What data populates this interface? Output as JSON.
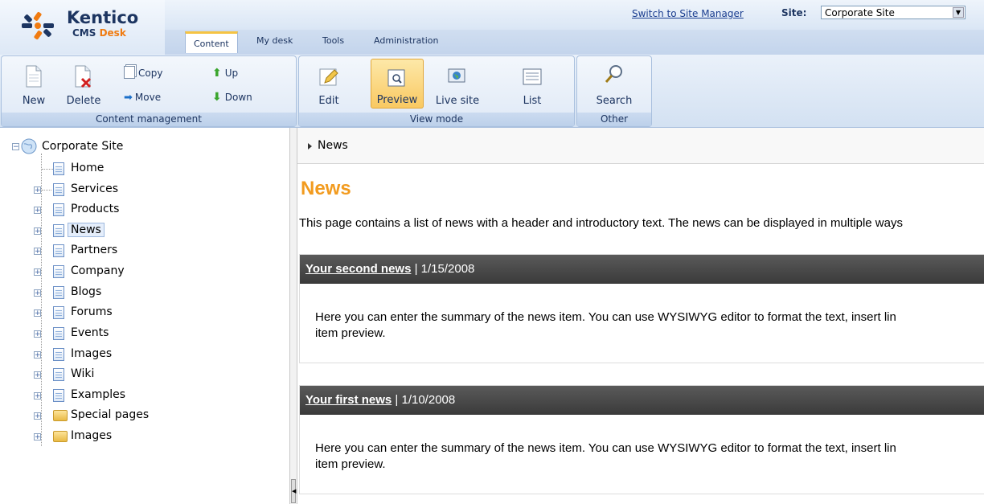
{
  "header": {
    "logo_name": "Kentico",
    "logo_product_cms": "CMS",
    "logo_product_desk": "Desk",
    "switch_link": "Switch to Site Manager",
    "site_label": "Site:",
    "site_value": "Corporate Site",
    "tabs": [
      {
        "label": "Content",
        "active": true
      },
      {
        "label": "My desk",
        "active": false
      },
      {
        "label": "Tools",
        "active": false
      },
      {
        "label": "Administration",
        "active": false
      }
    ]
  },
  "ribbon": {
    "content_management": {
      "label": "Content management",
      "new": "New",
      "delete": "Delete",
      "copy": "Copy",
      "move": "Move",
      "up": "Up",
      "down": "Down"
    },
    "view_mode": {
      "label": "View mode",
      "edit": "Edit",
      "preview": "Preview",
      "live_site": "Live site",
      "list": "List",
      "selected": "Preview"
    },
    "other": {
      "label": "Other",
      "search": "Search"
    }
  },
  "tree": {
    "root": "Corporate Site",
    "items": [
      {
        "label": "Home",
        "type": "document",
        "expandable": false
      },
      {
        "label": "Services",
        "type": "document",
        "expandable": true
      },
      {
        "label": "Products",
        "type": "document",
        "expandable": true
      },
      {
        "label": "News",
        "type": "document",
        "expandable": true,
        "selected": true
      },
      {
        "label": "Partners",
        "type": "document",
        "expandable": true
      },
      {
        "label": "Company",
        "type": "document",
        "expandable": true
      },
      {
        "label": "Blogs",
        "type": "document",
        "expandable": true
      },
      {
        "label": "Forums",
        "type": "document",
        "expandable": true
      },
      {
        "label": "Events",
        "type": "document",
        "expandable": true
      },
      {
        "label": "Images",
        "type": "document",
        "expandable": true
      },
      {
        "label": "Wiki",
        "type": "document",
        "expandable": true
      },
      {
        "label": "Examples",
        "type": "document",
        "expandable": true
      },
      {
        "label": "Special pages",
        "type": "folder",
        "expandable": true
      },
      {
        "label": "Images",
        "type": "folder",
        "expandable": true
      }
    ]
  },
  "content": {
    "breadcrumb": "News",
    "title": "News",
    "intro": "This page contains a list of news with a header and introductory text. The news can be displayed in multiple ways",
    "news": [
      {
        "title": "Your second news",
        "date": "| 1/15/2008",
        "summary": "Here you can enter the summary of the news item. You can use WYSIWYG editor to format the text, insert lin",
        "summary2": "item preview."
      },
      {
        "title": "Your first news",
        "date": "| 1/10/2008",
        "summary": "Here you can enter the summary of the news item. You can use WYSIWYG editor to format the text, insert lin",
        "summary2": "item preview."
      }
    ]
  },
  "colors": {
    "accent_orange": "#f29b1f",
    "brand_navy": "#1d3561",
    "news_header_bg": "#444444"
  }
}
